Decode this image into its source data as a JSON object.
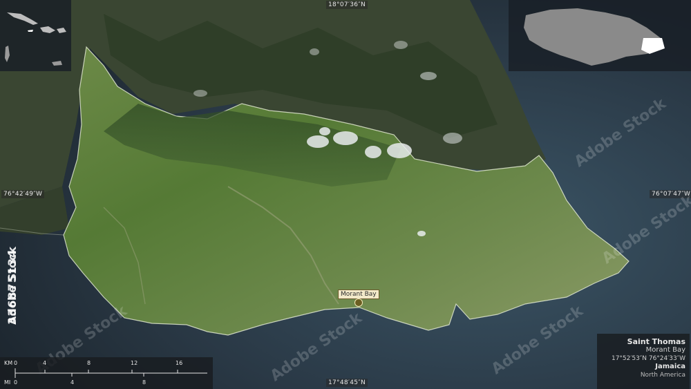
{
  "coordinates": {
    "top": "18°07′36″N",
    "bottom": "17°48′45″N",
    "left": "76°42′49″W",
    "right": "76°07′47″W"
  },
  "info": {
    "region": "Saint Thomas",
    "capital": "Morant Bay",
    "coords": "17°52′53″N 76°24′33″W",
    "country": "Jamaica",
    "continent": "North America"
  },
  "city": {
    "name": "Morant Bay"
  },
  "scale": {
    "km_label": "KM",
    "mi_label": "MI",
    "km_ticks": [
      "0",
      "4",
      "8",
      "12",
      "16"
    ],
    "mi_ticks": [
      "0",
      "4",
      "8"
    ]
  },
  "watermark": {
    "id": "336875134",
    "brand": "Adobe Stock",
    "repeat": "Adobe Stock"
  },
  "colors": {
    "sea": "#2b3a46",
    "land_outside": "#2e3a2b",
    "region_fill": "#5b7a3c",
    "inset_country": "#8a8a8a",
    "inset_highlight": "#ffffff"
  }
}
